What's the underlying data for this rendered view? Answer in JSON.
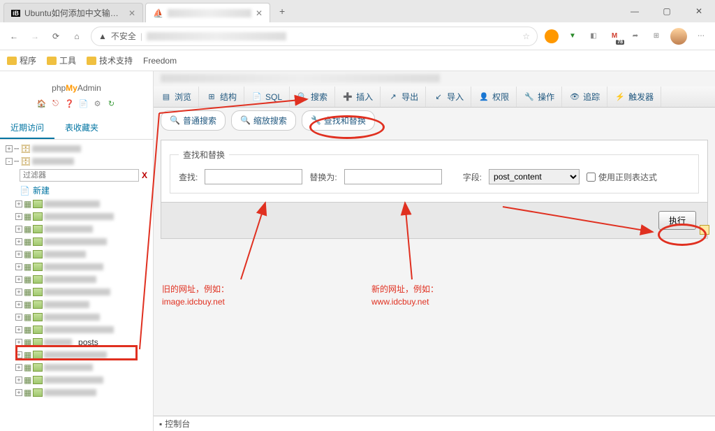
{
  "browser": {
    "tabs": [
      {
        "title": "Ubuntu如何添加中文输入法 / H",
        "active": false
      },
      {
        "title": "",
        "active": true
      }
    ],
    "url_warning": "不安全",
    "gmail_badge": "78",
    "bookmarks": [
      "程序",
      "工具",
      "技术支持",
      "Freedom"
    ]
  },
  "sidebar": {
    "logo_php": "php",
    "logo_my": "My",
    "logo_admin": "Admin",
    "tab_recent": "近期访问",
    "tab_favorites": "表收藏夹",
    "filter_placeholder": "过滤器",
    "new_label": "新建",
    "posts_table": "_posts"
  },
  "menu": {
    "browse": "浏览",
    "structure": "结构",
    "sql": "SQL",
    "search": "搜索",
    "insert": "插入",
    "export": "导出",
    "import": "导入",
    "privileges": "权限",
    "operations": "操作",
    "tracking": "追踪",
    "triggers": "触发器"
  },
  "search_tabs": {
    "normal": "普通搜索",
    "zoom": "缩放搜索",
    "find_replace": "查找和替换"
  },
  "form": {
    "legend": "查找和替换",
    "find_label": "查找:",
    "replace_label": "替换为:",
    "field_label": "字段:",
    "field_value": "post_content",
    "regex_label": "使用正则表达式",
    "submit": "执行"
  },
  "console": "控制台",
  "annotations": {
    "old_url_line1": "旧的网址，例如：",
    "old_url_line2": "image.idcbuy.net",
    "new_url_line1": "新的网址，例如：",
    "new_url_line2": "www.idcbuy.net"
  }
}
